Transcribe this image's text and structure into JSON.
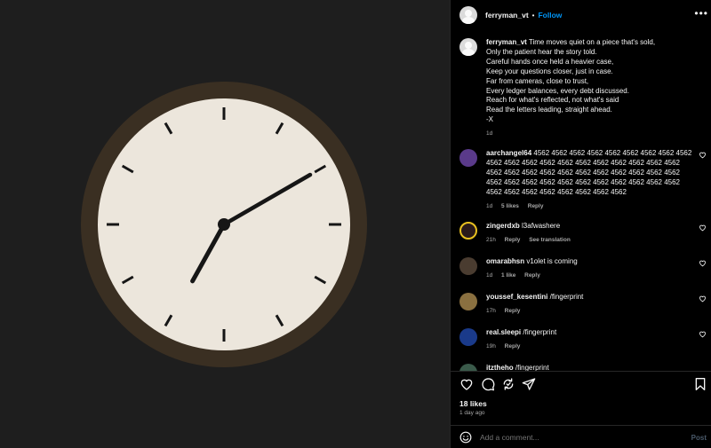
{
  "post": {
    "username": "ferryman_vt",
    "separator": "•",
    "follow_label": "Follow",
    "more_label": "•••"
  },
  "caption": {
    "username": "ferryman_vt",
    "lines": [
      "Time moves quiet on a piece that's sold,",
      "Only the patient hear the story told.",
      "Careful hands once held a heavier case,",
      "Keep your questions closer, just in case.",
      "Far from cameras, close to trust,",
      "Every ledger balances, every debt discussed.",
      "Reach for what's reflected, not what's said",
      "Read the letters leading, straight ahead.",
      "-X"
    ],
    "time": "1d"
  },
  "comments": [
    {
      "username": "aarchangel64",
      "text": "4562 4562 4562 4562 4562 4562 4562 4562 4562 4562 4562 4562 4562 4562 4562 4562 4562 4562 4562 4562 4562 4562 4562 4562 4562 4562 4562 4562 4562 4562 4562 4562 4562 4562 4562 4562 4562 4562 4562 4562 4562 4562 4562 4562 4562 4562 4562 4562 4562 4562",
      "time": "1d",
      "likes": "5 likes",
      "reply": "Reply",
      "extra": "",
      "avatar_color": "#5a3a8a"
    },
    {
      "username": "zingerdxb",
      "text": "l3afwashere",
      "time": "21h",
      "likes": "",
      "reply": "Reply",
      "extra": "See translation",
      "avatar_color": "#2a1a1a"
    },
    {
      "username": "omarabhsn",
      "text": "v1olet is coming",
      "time": "1d",
      "likes": "1 like",
      "reply": "Reply",
      "extra": "",
      "avatar_color": "#4a3c30"
    },
    {
      "username": "youssef_kesentini",
      "text": "/fingerprint",
      "time": "17h",
      "likes": "",
      "reply": "Reply",
      "extra": "",
      "avatar_color": "#8a7040"
    },
    {
      "username": "real.sleepi",
      "text": "/fingerprint",
      "time": "19h",
      "likes": "",
      "reply": "Reply",
      "extra": "",
      "avatar_color": "#1a3a8a"
    },
    {
      "username": "itztheho",
      "text": "/fingerprint",
      "time": "",
      "likes": "",
      "reply": "",
      "extra": "",
      "avatar_color": "#3a5a4a"
    }
  ],
  "footer": {
    "likes": "18 likes",
    "ago": "1 day ago",
    "add_placeholder": "Add a comment...",
    "post_label": "Post"
  },
  "icons": {
    "like": "heart-icon",
    "comment": "comment-icon",
    "repost": "repost-icon",
    "share": "share-icon",
    "save": "bookmark-icon",
    "emoji": "emoji-icon"
  },
  "colors": {
    "clock_rim": "#3a2f22",
    "clock_face": "#ece6dc",
    "clock_marks": "#161616",
    "link_blue": "#0095f6",
    "background": "#1e1e1e"
  },
  "clock": {
    "hour_hand_minutes": 1858,
    "minute_hand_minutes": 10
  }
}
